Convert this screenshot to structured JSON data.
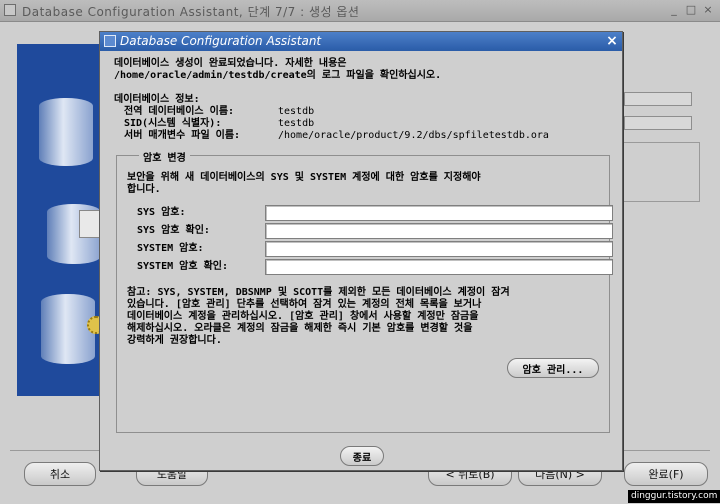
{
  "background_window": {
    "title": "Database Configuration Assistant, 단계 7/7 : 생성 옵션",
    "controls": [
      "_",
      "□",
      "×"
    ],
    "buttons": {
      "cancel": "취소",
      "help": "도움말",
      "back": "< 뒤로(B)",
      "next": "다음(N) >",
      "finish": "완료(F)"
    }
  },
  "dialog": {
    "title": "Database Configuration Assistant",
    "close": "×",
    "intro_line1": "데이터베이스 생성이 완료되었습니다. 자세한 내용은",
    "intro_line2": "/home/oracle/admin/testdb/create의 로그 파일을 확인하십시오.",
    "info_heading": "데이터베이스 정보:",
    "info": [
      {
        "label": "전역 데이터베이스 이름:",
        "value": "testdb"
      },
      {
        "label": "SID(시스템 식별자):",
        "value": "testdb"
      },
      {
        "label": "서버 매개변수 파일 이름:",
        "value": "/home/oracle/product/9.2/dbs/spfiletestdb.ora"
      }
    ],
    "password_group": {
      "legend": "암호 변경",
      "desc_line1": "보안을 위해 새 데이터베이스의 SYS 및 SYSTEM 계정에 대한 암호를 지정해야",
      "desc_line2": "합니다.",
      "fields": [
        {
          "label": "SYS 암호:",
          "value": ""
        },
        {
          "label": "SYS 암호 확인:",
          "value": ""
        },
        {
          "label": "SYSTEM 암호:",
          "value": ""
        },
        {
          "label": "SYSTEM 암호 확인:",
          "value": ""
        }
      ],
      "note": [
        "참고: SYS, SYSTEM, DBSNMP 및 SCOTT를 제외한 모든 데이터베이스 계정이 잠겨",
        "있습니다. [암호 관리] 단추를 선택하여 잠겨 있는 계정의 전체 목록을 보거나",
        "데이터베이스 계정을 관리하십시오. [암호 관리] 창에서 사용할 계정만 잠금을",
        "해제하십시오. 오라클은 계정의 잠금을 해제한 즉시 기본 암호를 변경할 것을",
        "강력하게 권장합니다."
      ],
      "manage_button": "암호 관리..."
    },
    "exit_button": "종료"
  },
  "watermark": "dinggur.tistory.com"
}
